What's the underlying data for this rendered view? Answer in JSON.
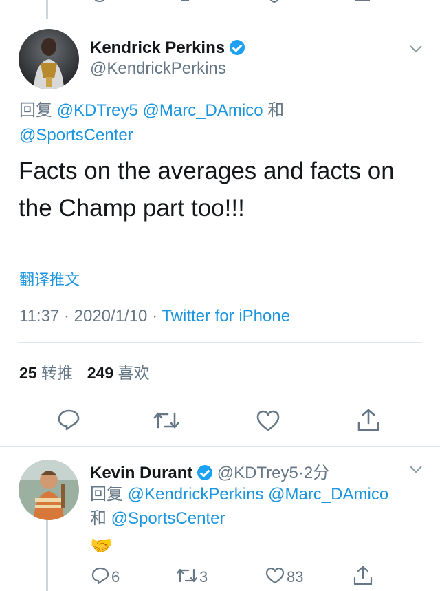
{
  "main_tweet": {
    "author_name": "Kendrick Perkins",
    "author_handle": "@KendrickPerkins",
    "reply_prefix": "回复",
    "reply_to_1": "@KDTrey5",
    "reply_to_2": "@Marc_DAmico",
    "reply_joiner": "和",
    "reply_to_3": "@SportsCenter",
    "text_line1": "Facts on the averages and facts on",
    "text_line2": "the Champ part too!!!",
    "translate_label": "翻译推文",
    "time": "11:37",
    "date": "2020/1/10",
    "separator": "·",
    "client": "Twitter for iPhone",
    "retweet_count": "25",
    "retweet_label": "转推",
    "like_count": "249",
    "like_label": "喜欢"
  },
  "reply_tweet": {
    "author_name": "Kevin Durant",
    "author_handle": "@KDTrey5",
    "separator": "·",
    "time_ago": "2分",
    "reply_prefix": "回复",
    "reply_to_1": "@KendrickPerkins",
    "reply_to_2": "@Marc_DAmico",
    "reply_joiner": "和",
    "reply_to_3": "@SportsCenter",
    "emoji": "🤝",
    "reply_count": "6",
    "retweet_count": "3",
    "like_count": "83"
  },
  "colors": {
    "link": "#1b95e0",
    "secondary_text": "#657786",
    "verified": "#1da1f2",
    "divider": "#e1e8ed"
  },
  "icons": [
    "verified-badge-icon",
    "chevron-down-icon",
    "reply-icon",
    "retweet-icon",
    "like-icon",
    "share-icon"
  ]
}
